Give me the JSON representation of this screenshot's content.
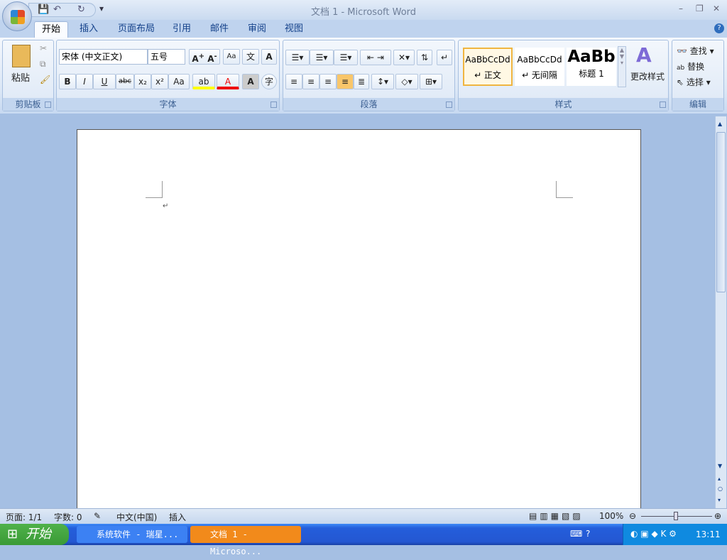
{
  "window": {
    "title": "文档 1 - Microsoft Word"
  },
  "qat": {
    "save": "💾",
    "undo": "↶",
    "redo": "↻",
    "customize": "▾"
  },
  "tabs": [
    "开始",
    "插入",
    "页面布局",
    "引用",
    "邮件",
    "审阅",
    "视图"
  ],
  "clipboard": {
    "paste": "粘贴",
    "label": "剪贴板"
  },
  "font": {
    "name": "宋体 (中文正文)",
    "size": "五号",
    "label": "字体",
    "buttons": [
      "B",
      "I",
      "U",
      "abc",
      "x₂",
      "x²",
      "Aa",
      "ab",
      "A",
      "A",
      "字"
    ],
    "grow": "A",
    "shrink": "A",
    "clear": "Aa",
    "phonetic": "文",
    "border": "A"
  },
  "paragraph": {
    "label": "段落"
  },
  "styles": {
    "label": "样式",
    "items": [
      {
        "preview": "AaBbCcDd",
        "name": "↵ 正文"
      },
      {
        "preview": "AaBbCcDd",
        "name": "↵ 无间隔"
      },
      {
        "preview": "AaBb",
        "name": "标题 1"
      }
    ],
    "change": "更改样式"
  },
  "editing": {
    "label": "编辑",
    "find": "查找",
    "replace": "替换",
    "select": "选择"
  },
  "document": {
    "paragraph_mark": "↵"
  },
  "status": {
    "page": "页面: 1/1",
    "words": "字数: 0",
    "language": "中文(中国)",
    "mode": "插入",
    "zoom": "100%"
  },
  "taskbar": {
    "start": "开始",
    "tasks": [
      "系统软件 - 瑞星...",
      "文档 1 - Microso..."
    ],
    "clock": "13:11"
  },
  "colors": {
    "accent": "#15428b",
    "taskbar": "#245edb",
    "start": "#3a9a36",
    "active_task": "#f28a1b",
    "highlight": "#ffff00",
    "font_color": "#e00000"
  }
}
